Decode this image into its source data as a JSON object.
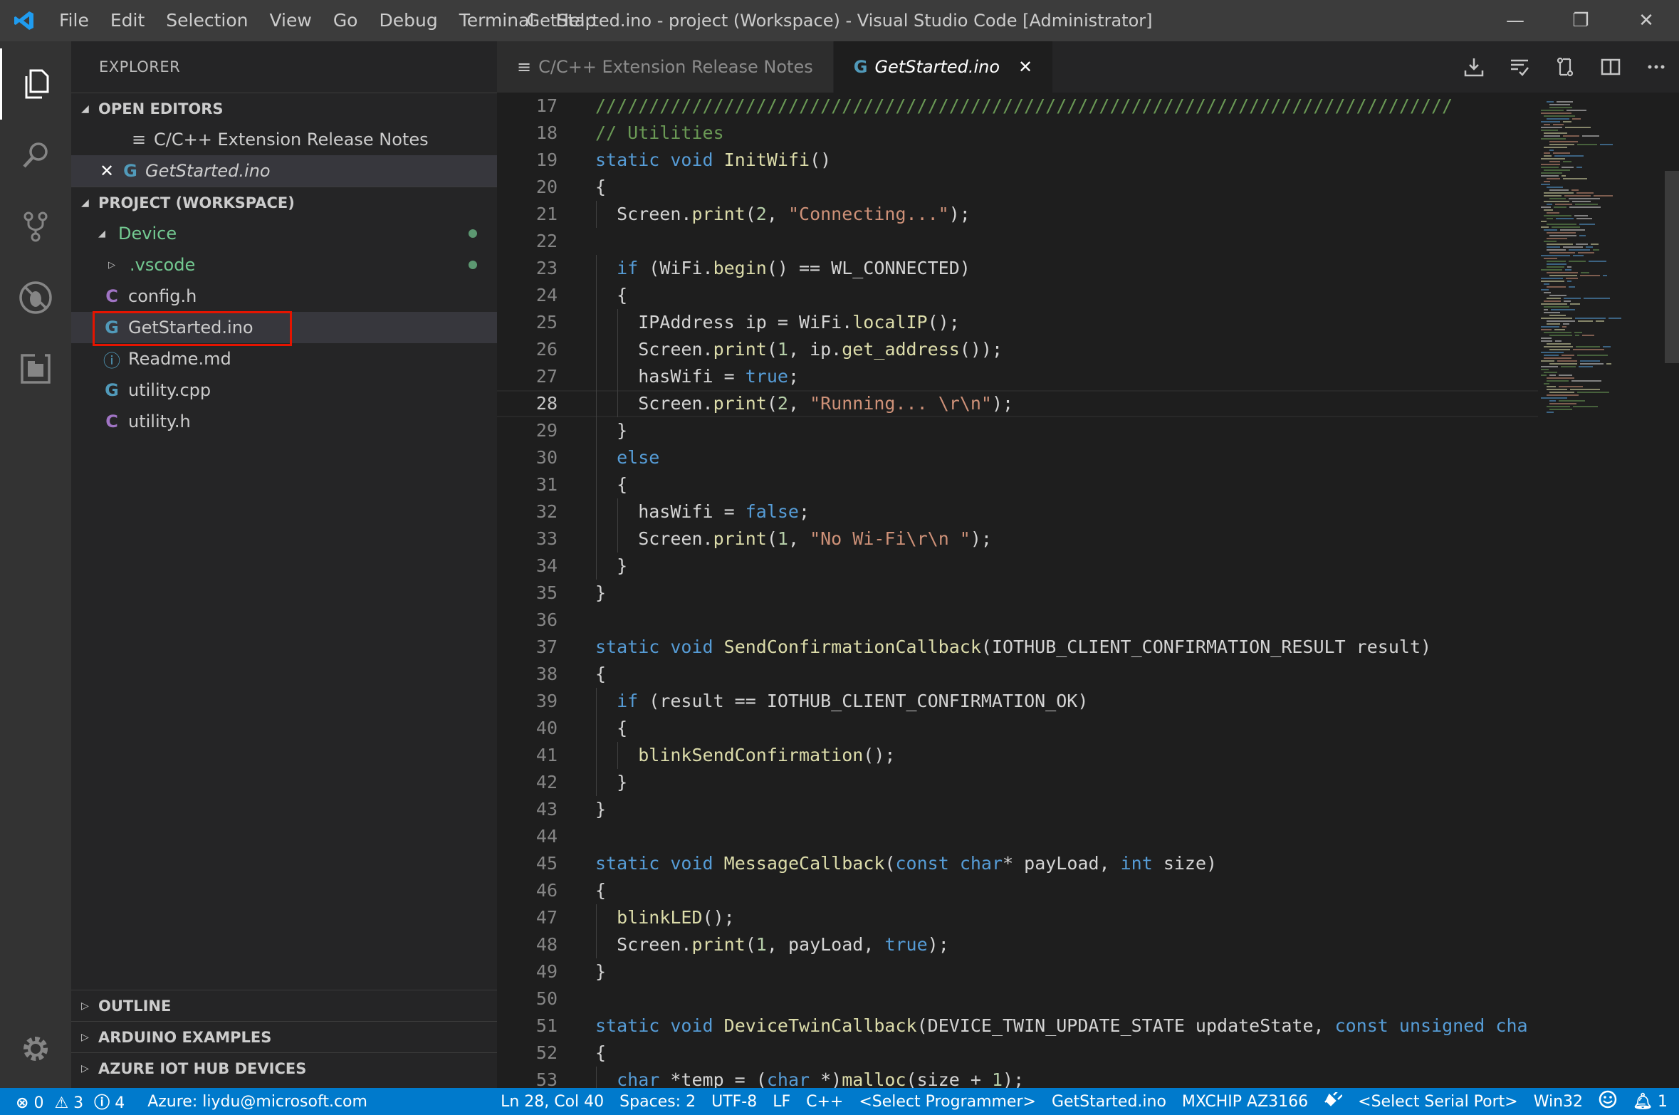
{
  "window": {
    "title": "GetStarted.ino - project (Workspace) - Visual Studio Code [Administrator]",
    "menu": [
      "File",
      "Edit",
      "Selection",
      "View",
      "Go",
      "Debug",
      "Terminal",
      "Help"
    ],
    "minimize": "—",
    "restore": "❐",
    "close": "✕"
  },
  "sidebar": {
    "title": "EXPLORER",
    "open_editors_label": "OPEN EDITORS",
    "open_editors": [
      {
        "name": "C/C++ Extension Release Notes",
        "icon": "≡",
        "close": ""
      },
      {
        "name": "GetStarted.ino",
        "icon": "G",
        "close": "✕"
      }
    ],
    "project_label": "PROJECT (WORKSPACE)",
    "tree": [
      {
        "name": "Device",
        "twisty": "◢"
      },
      {
        "name": ".vscode",
        "twisty": "▷"
      },
      {
        "name": "config.h",
        "icon": "C"
      },
      {
        "name": "GetStarted.ino",
        "icon": "G"
      },
      {
        "name": "Readme.md",
        "icon": "ⓘ"
      },
      {
        "name": "utility.cpp",
        "icon": "G"
      },
      {
        "name": "utility.h",
        "icon": "C"
      }
    ],
    "outline_label": "OUTLINE",
    "arduino_label": "ARDUINO EXAMPLES",
    "azure_label": "AZURE IOT HUB DEVICES"
  },
  "tabs": [
    {
      "label": "C/C++ Extension Release Notes",
      "icon": "≡"
    },
    {
      "label": "GetStarted.ino",
      "icon": "G",
      "close": "✕"
    }
  ],
  "editor": {
    "current_line": 28,
    "lines": [
      {
        "n": 17,
        "t": "////////////////////////////////////////////////////////////////////////////////"
      },
      {
        "n": 18,
        "t": "// Utilities"
      },
      {
        "n": 19,
        "t": "static void InitWifi()"
      },
      {
        "n": 20,
        "t": "{"
      },
      {
        "n": 21,
        "t": "  Screen.print(2, \"Connecting...\");"
      },
      {
        "n": 22,
        "t": ""
      },
      {
        "n": 23,
        "t": "  if (WiFi.begin() == WL_CONNECTED)"
      },
      {
        "n": 24,
        "t": "  {"
      },
      {
        "n": 25,
        "t": "    IPAddress ip = WiFi.localIP();"
      },
      {
        "n": 26,
        "t": "    Screen.print(1, ip.get_address());"
      },
      {
        "n": 27,
        "t": "    hasWifi = true;"
      },
      {
        "n": 28,
        "t": "    Screen.print(2, \"Running... \\r\\n\");"
      },
      {
        "n": 29,
        "t": "  }"
      },
      {
        "n": 30,
        "t": "  else"
      },
      {
        "n": 31,
        "t": "  {"
      },
      {
        "n": 32,
        "t": "    hasWifi = false;"
      },
      {
        "n": 33,
        "t": "    Screen.print(1, \"No Wi-Fi\\r\\n \");"
      },
      {
        "n": 34,
        "t": "  }"
      },
      {
        "n": 35,
        "t": "}"
      },
      {
        "n": 36,
        "t": ""
      },
      {
        "n": 37,
        "t": "static void SendConfirmationCallback(IOTHUB_CLIENT_CONFIRMATION_RESULT result)"
      },
      {
        "n": 38,
        "t": "{"
      },
      {
        "n": 39,
        "t": "  if (result == IOTHUB_CLIENT_CONFIRMATION_OK)"
      },
      {
        "n": 40,
        "t": "  {"
      },
      {
        "n": 41,
        "t": "    blinkSendConfirmation();"
      },
      {
        "n": 42,
        "t": "  }"
      },
      {
        "n": 43,
        "t": "}"
      },
      {
        "n": 44,
        "t": ""
      },
      {
        "n": 45,
        "t": "static void MessageCallback(const char* payLoad, int size)"
      },
      {
        "n": 46,
        "t": "{"
      },
      {
        "n": 47,
        "t": "  blinkLED();"
      },
      {
        "n": 48,
        "t": "  Screen.print(1, payLoad, true);"
      },
      {
        "n": 49,
        "t": "}"
      },
      {
        "n": 50,
        "t": ""
      },
      {
        "n": 51,
        "t": "static void DeviceTwinCallback(DEVICE_TWIN_UPDATE_STATE updateState, const unsigned cha"
      },
      {
        "n": 52,
        "t": "{"
      },
      {
        "n": 53,
        "t": "  char *temp = (char *)malloc(size + 1);"
      }
    ]
  },
  "status": {
    "errors": "0",
    "warnings": "3",
    "infos": "4",
    "azure": "Azure: liydu@microsoft.com",
    "position": "Ln 28, Col 40",
    "spaces": "Spaces: 2",
    "encoding": "UTF-8",
    "eol": "LF",
    "language": "C++",
    "programmer": "<Select Programmer>",
    "sketch": "GetStarted.ino",
    "board": "MXCHIP AZ3166",
    "serial": "<Select Serial Port>",
    "platform": "Win32",
    "notifications": "1"
  },
  "colors": {
    "status_bar": "#007acc",
    "highlight_box": "#e51400",
    "git_modified": "#73c991"
  }
}
